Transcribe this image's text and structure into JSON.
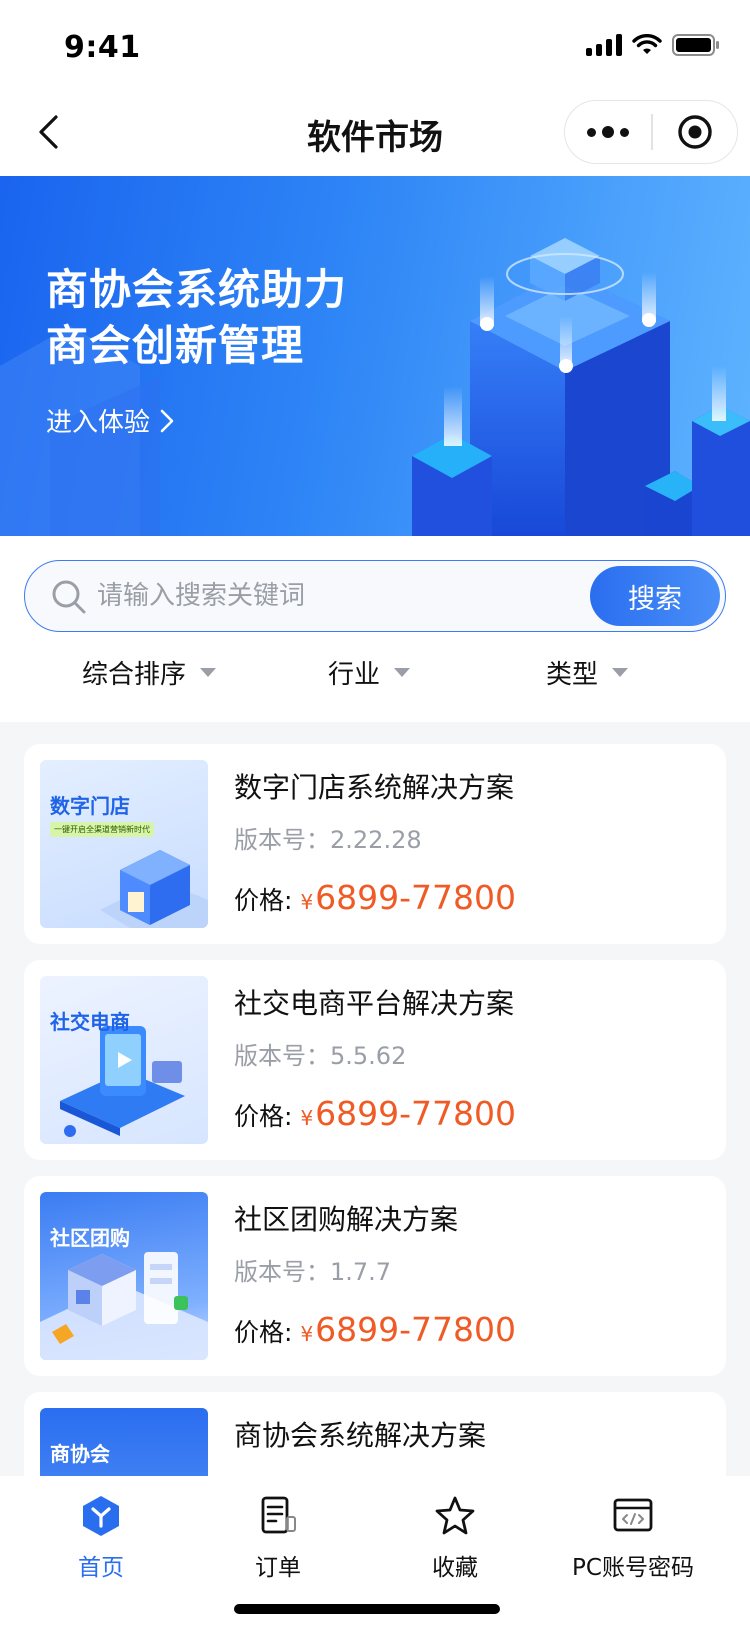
{
  "status_bar": {
    "time": "9:41"
  },
  "nav": {
    "title": "软件市场"
  },
  "banner": {
    "title": "商协会系统助力\n商会创新管理",
    "cta": "进入体验"
  },
  "search": {
    "placeholder": "请输入搜索关键词",
    "button_label": "搜索"
  },
  "filters": [
    {
      "label": "综合排序"
    },
    {
      "label": "行业"
    },
    {
      "label": "类型"
    }
  ],
  "products": [
    {
      "thumb_label": "数字门店",
      "thumb_sub": "一键开启全渠道营销新时代",
      "title": "数字门店系统解决方案",
      "version_label": "版本号：",
      "version": "2.22.28",
      "price_label": "价格:",
      "currency": "¥",
      "price": "6899-77800"
    },
    {
      "thumb_label": "社交电商",
      "title": "社交电商平台解决方案",
      "version_label": "版本号：",
      "version": "5.5.62",
      "price_label": "价格:",
      "currency": "¥",
      "price": "6899-77800"
    },
    {
      "thumb_label": "社区团购",
      "title": "社区团购解决方案",
      "version_label": "版本号：",
      "version": "1.7.7",
      "price_label": "价格:",
      "currency": "¥",
      "price": "6899-77800"
    },
    {
      "thumb_label": "商协会",
      "title": "商协会系统解决方案"
    }
  ],
  "tabs": [
    {
      "label": "首页",
      "active": true
    },
    {
      "label": "订单"
    },
    {
      "label": "收藏"
    },
    {
      "label": "PC账号密码"
    }
  ],
  "colors": {
    "accent": "#2a6ef0",
    "price": "#f05a24"
  }
}
